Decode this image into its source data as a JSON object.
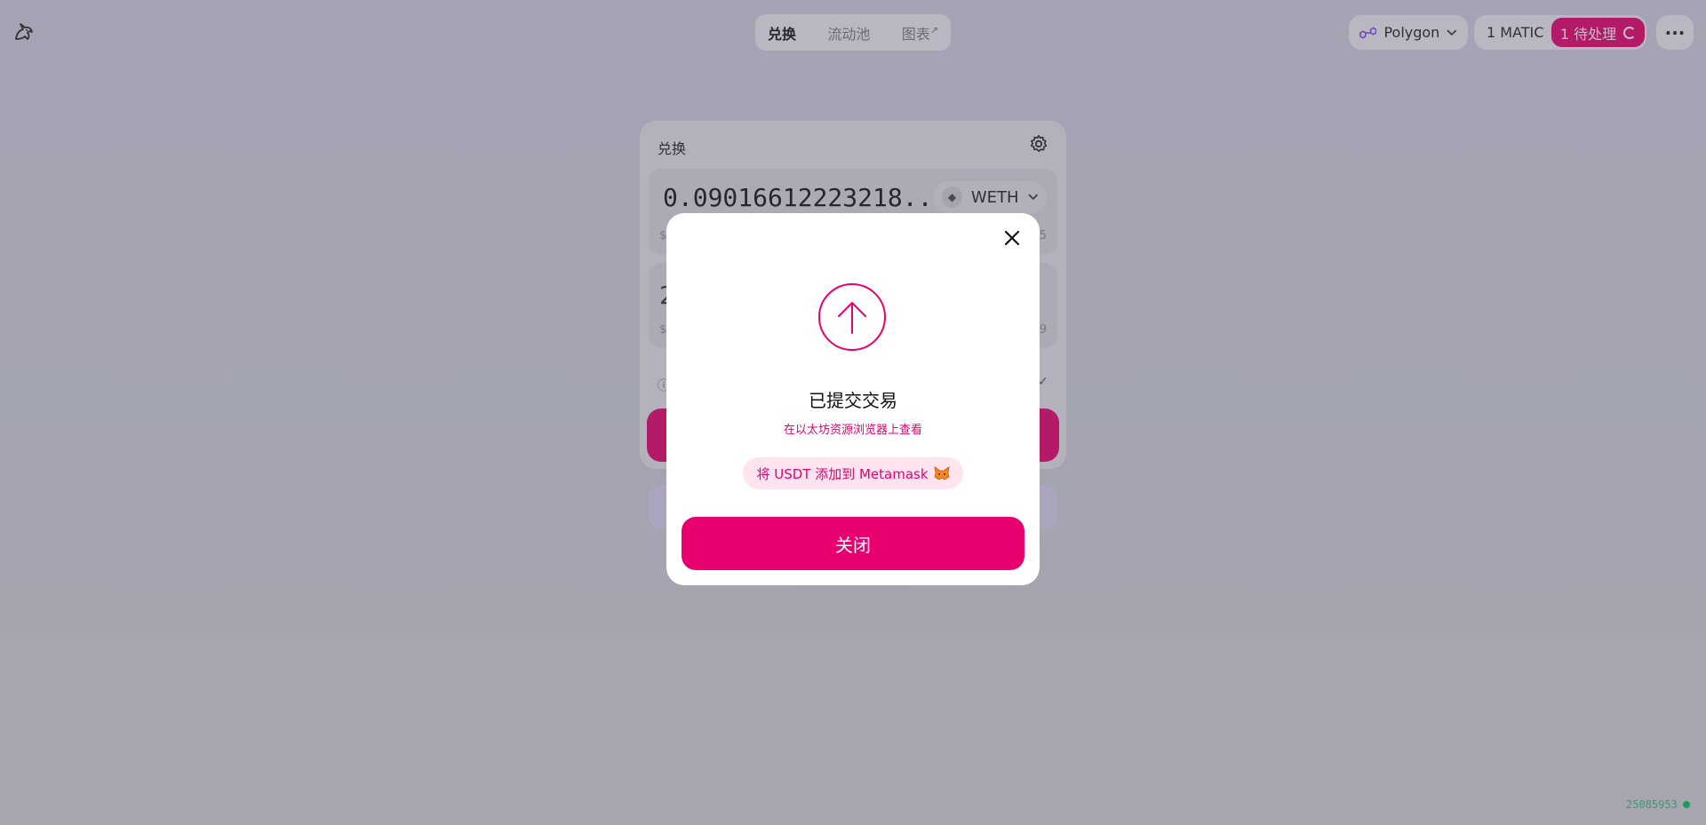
{
  "header": {
    "logo_icon": "unicorn-icon",
    "nav": [
      {
        "label": "兑换",
        "active": true
      },
      {
        "label": "流动池",
        "active": false
      },
      {
        "label": "图表",
        "suffix": "↗",
        "active": false
      }
    ],
    "network": {
      "label": "Polygon",
      "icon": "polygon-icon"
    },
    "wallet": {
      "balance": "1 MATIC",
      "pending_label": "1 待处理"
    },
    "more_icon": "ellipsis-icon"
  },
  "swap": {
    "title": "兑换",
    "settings_icon": "gear-icon",
    "input": {
      "amount": "0.09016612223218...",
      "token": "WETH",
      "token_icon": "ethereum-icon"
    },
    "output": {
      "amount": "2"
    }
  },
  "modal": {
    "title": "已提交交易",
    "explorer_link": "在以太坊资源浏览器上查看",
    "add_token_label": "将 USDT 添加到 Metamask",
    "add_token_icon": "metamask-fox-icon",
    "close_button": "关闭"
  },
  "footer": {
    "block_number": "25085953",
    "status_color": "#1d9a5a"
  },
  "colors": {
    "accent": "#e8006f",
    "accent_light": "#fde4ef"
  }
}
